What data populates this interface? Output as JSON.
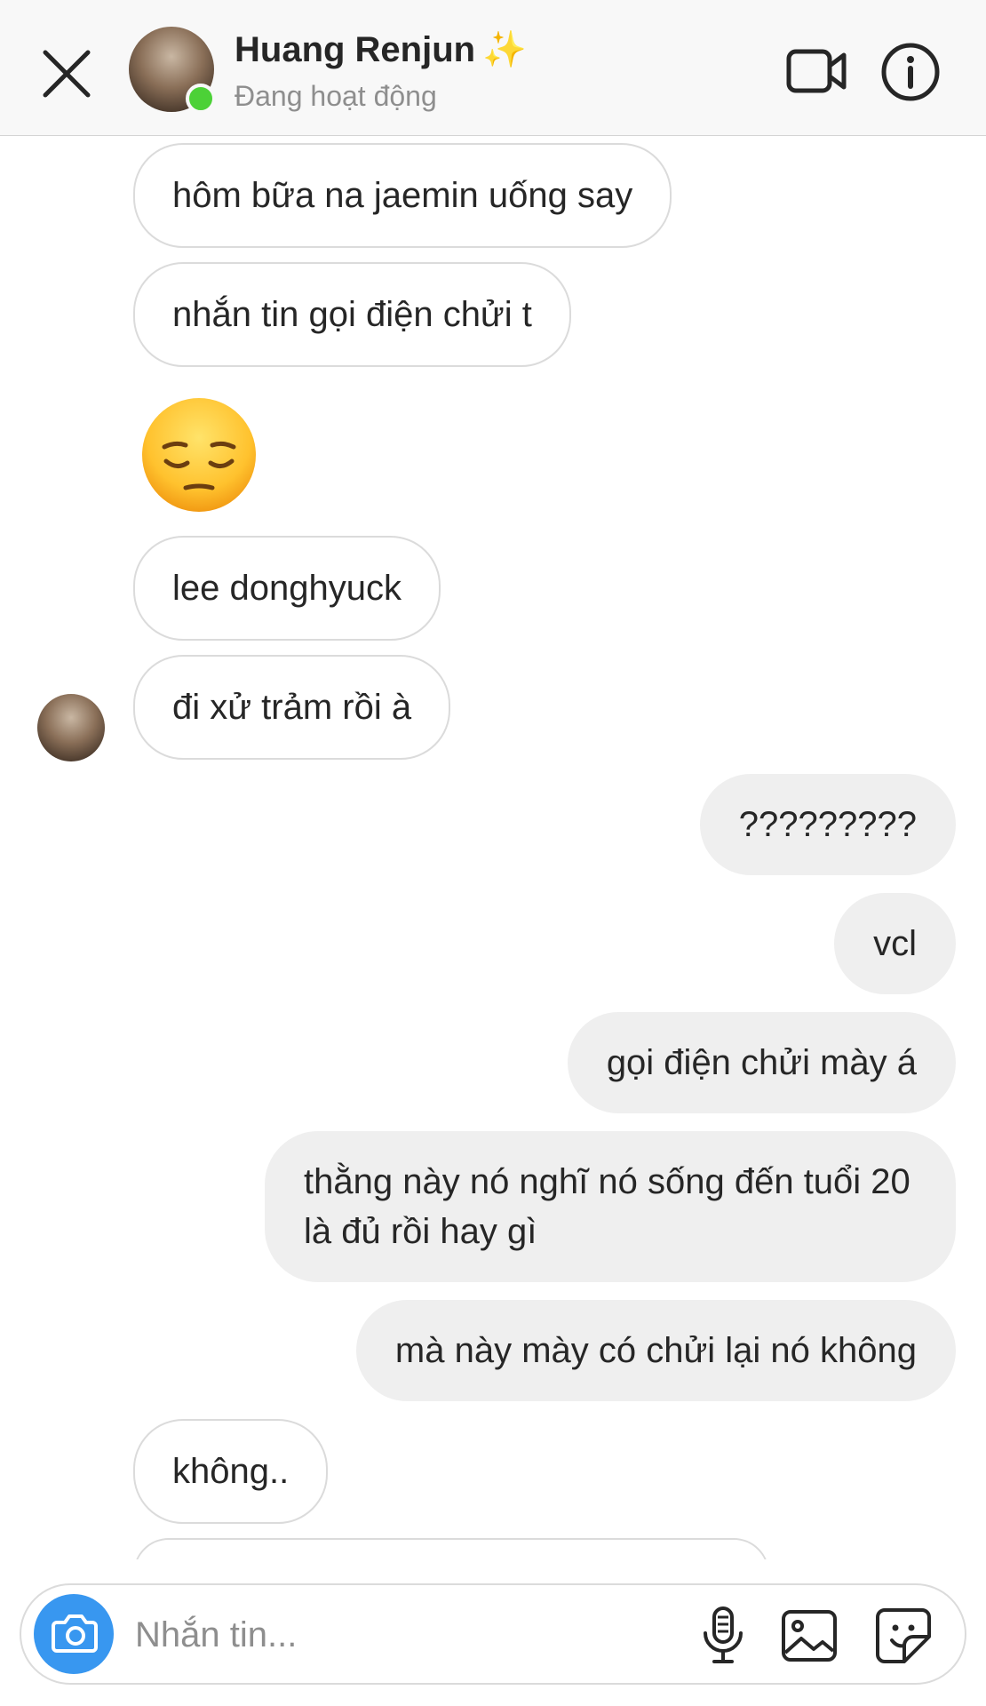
{
  "header": {
    "contact_name": "Huang Renjun",
    "name_decoration": "✨",
    "status": "Đang hoạt động",
    "icons": {
      "close": "close-icon",
      "video": "video-call-icon",
      "info": "info-icon"
    }
  },
  "messages": [
    {
      "direction": "incoming",
      "text": "hôm bữa na jaemin uống say"
    },
    {
      "direction": "incoming",
      "text": "nhắn tin gọi điện chửi t"
    },
    {
      "direction": "incoming",
      "type": "emoji",
      "text": "😔",
      "emoji": "pensive-face"
    },
    {
      "direction": "incoming",
      "text": "lee donghyuck"
    },
    {
      "direction": "incoming",
      "text": "đi xử trảm rồi à"
    },
    {
      "direction": "outgoing",
      "text": "?????????"
    },
    {
      "direction": "outgoing",
      "text": "vcl"
    },
    {
      "direction": "outgoing",
      "text": "gọi điện chửi mày á"
    },
    {
      "direction": "outgoing",
      "text": "thằng này nó nghĩ nó sống đến tuổi 20 là đủ rồi hay gì"
    },
    {
      "direction": "outgoing",
      "text": "mà này mày có chửi lại nó không"
    },
    {
      "direction": "incoming",
      "text": "không.."
    }
  ],
  "composer": {
    "placeholder": "Nhắn tin...",
    "icons": [
      "camera-icon",
      "microphone-icon",
      "gallery-icon",
      "sticker-icon"
    ]
  },
  "colors": {
    "accent": "#3897f0",
    "online": "#4cd137",
    "outgoing_bubble": "#efefef",
    "incoming_border": "#dbdbdb",
    "muted_text": "#8e8e8e"
  }
}
